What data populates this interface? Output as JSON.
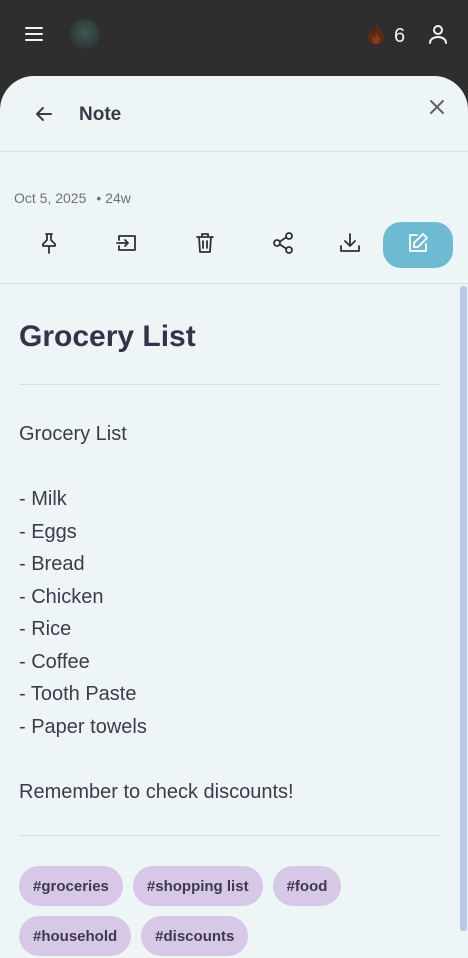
{
  "topbar": {
    "streak_count": "6"
  },
  "note_view": {
    "header_title": "Note",
    "date": "Oct 5, 2025",
    "age": "• 24w",
    "toolbar": [
      "pin-icon",
      "move-icon",
      "trash-icon",
      "share-icon",
      "download-icon",
      "edit-icon"
    ],
    "accent_color": "#6fbad3"
  },
  "note": {
    "title": "Grocery List",
    "body": "Grocery List\n\n- Milk\n- Eggs\n- Bread\n- Chicken\n- Rice\n- Coffee\n- Tooth Paste\n- Paper towels\n\nRemember to check discounts!",
    "tags": [
      "#groceries",
      "#shopping list",
      "#food",
      "#household",
      "#discounts"
    ]
  }
}
